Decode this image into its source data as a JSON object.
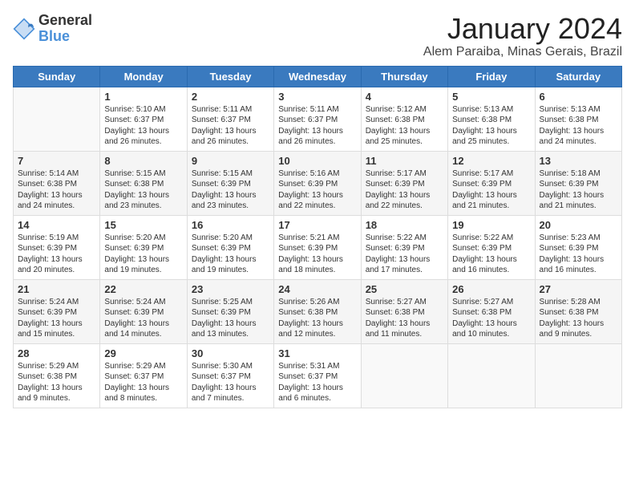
{
  "logo": {
    "general": "General",
    "blue": "Blue"
  },
  "title": "January 2024",
  "subtitle": "Alem Paraiba, Minas Gerais, Brazil",
  "days_of_week": [
    "Sunday",
    "Monday",
    "Tuesday",
    "Wednesday",
    "Thursday",
    "Friday",
    "Saturday"
  ],
  "weeks": [
    [
      {
        "day": "",
        "info": ""
      },
      {
        "day": "1",
        "info": "Sunrise: 5:10 AM\nSunset: 6:37 PM\nDaylight: 13 hours\nand 26 minutes."
      },
      {
        "day": "2",
        "info": "Sunrise: 5:11 AM\nSunset: 6:37 PM\nDaylight: 13 hours\nand 26 minutes."
      },
      {
        "day": "3",
        "info": "Sunrise: 5:11 AM\nSunset: 6:37 PM\nDaylight: 13 hours\nand 26 minutes."
      },
      {
        "day": "4",
        "info": "Sunrise: 5:12 AM\nSunset: 6:38 PM\nDaylight: 13 hours\nand 25 minutes."
      },
      {
        "day": "5",
        "info": "Sunrise: 5:13 AM\nSunset: 6:38 PM\nDaylight: 13 hours\nand 25 minutes."
      },
      {
        "day": "6",
        "info": "Sunrise: 5:13 AM\nSunset: 6:38 PM\nDaylight: 13 hours\nand 24 minutes."
      }
    ],
    [
      {
        "day": "7",
        "info": "Sunrise: 5:14 AM\nSunset: 6:38 PM\nDaylight: 13 hours\nand 24 minutes."
      },
      {
        "day": "8",
        "info": "Sunrise: 5:15 AM\nSunset: 6:38 PM\nDaylight: 13 hours\nand 23 minutes."
      },
      {
        "day": "9",
        "info": "Sunrise: 5:15 AM\nSunset: 6:39 PM\nDaylight: 13 hours\nand 23 minutes."
      },
      {
        "day": "10",
        "info": "Sunrise: 5:16 AM\nSunset: 6:39 PM\nDaylight: 13 hours\nand 22 minutes."
      },
      {
        "day": "11",
        "info": "Sunrise: 5:17 AM\nSunset: 6:39 PM\nDaylight: 13 hours\nand 22 minutes."
      },
      {
        "day": "12",
        "info": "Sunrise: 5:17 AM\nSunset: 6:39 PM\nDaylight: 13 hours\nand 21 minutes."
      },
      {
        "day": "13",
        "info": "Sunrise: 5:18 AM\nSunset: 6:39 PM\nDaylight: 13 hours\nand 21 minutes."
      }
    ],
    [
      {
        "day": "14",
        "info": "Sunrise: 5:19 AM\nSunset: 6:39 PM\nDaylight: 13 hours\nand 20 minutes."
      },
      {
        "day": "15",
        "info": "Sunrise: 5:20 AM\nSunset: 6:39 PM\nDaylight: 13 hours\nand 19 minutes."
      },
      {
        "day": "16",
        "info": "Sunrise: 5:20 AM\nSunset: 6:39 PM\nDaylight: 13 hours\nand 19 minutes."
      },
      {
        "day": "17",
        "info": "Sunrise: 5:21 AM\nSunset: 6:39 PM\nDaylight: 13 hours\nand 18 minutes."
      },
      {
        "day": "18",
        "info": "Sunrise: 5:22 AM\nSunset: 6:39 PM\nDaylight: 13 hours\nand 17 minutes."
      },
      {
        "day": "19",
        "info": "Sunrise: 5:22 AM\nSunset: 6:39 PM\nDaylight: 13 hours\nand 16 minutes."
      },
      {
        "day": "20",
        "info": "Sunrise: 5:23 AM\nSunset: 6:39 PM\nDaylight: 13 hours\nand 16 minutes."
      }
    ],
    [
      {
        "day": "21",
        "info": "Sunrise: 5:24 AM\nSunset: 6:39 PM\nDaylight: 13 hours\nand 15 minutes."
      },
      {
        "day": "22",
        "info": "Sunrise: 5:24 AM\nSunset: 6:39 PM\nDaylight: 13 hours\nand 14 minutes."
      },
      {
        "day": "23",
        "info": "Sunrise: 5:25 AM\nSunset: 6:39 PM\nDaylight: 13 hours\nand 13 minutes."
      },
      {
        "day": "24",
        "info": "Sunrise: 5:26 AM\nSunset: 6:38 PM\nDaylight: 13 hours\nand 12 minutes."
      },
      {
        "day": "25",
        "info": "Sunrise: 5:27 AM\nSunset: 6:38 PM\nDaylight: 13 hours\nand 11 minutes."
      },
      {
        "day": "26",
        "info": "Sunrise: 5:27 AM\nSunset: 6:38 PM\nDaylight: 13 hours\nand 10 minutes."
      },
      {
        "day": "27",
        "info": "Sunrise: 5:28 AM\nSunset: 6:38 PM\nDaylight: 13 hours\nand 9 minutes."
      }
    ],
    [
      {
        "day": "28",
        "info": "Sunrise: 5:29 AM\nSunset: 6:38 PM\nDaylight: 13 hours\nand 9 minutes."
      },
      {
        "day": "29",
        "info": "Sunrise: 5:29 AM\nSunset: 6:37 PM\nDaylight: 13 hours\nand 8 minutes."
      },
      {
        "day": "30",
        "info": "Sunrise: 5:30 AM\nSunset: 6:37 PM\nDaylight: 13 hours\nand 7 minutes."
      },
      {
        "day": "31",
        "info": "Sunrise: 5:31 AM\nSunset: 6:37 PM\nDaylight: 13 hours\nand 6 minutes."
      },
      {
        "day": "",
        "info": ""
      },
      {
        "day": "",
        "info": ""
      },
      {
        "day": "",
        "info": ""
      }
    ]
  ]
}
